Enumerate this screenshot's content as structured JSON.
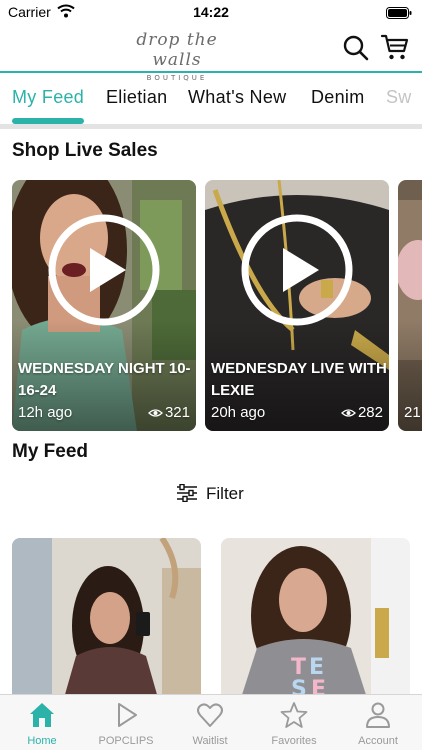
{
  "status": {
    "carrier": "Carrier",
    "time": "14:22"
  },
  "brand": {
    "logo_script": "drop the walls",
    "logo_sub": "BOUTIQUE"
  },
  "colors": {
    "accent": "#2bb3a9",
    "nav_inactive": "#9a9a9a"
  },
  "tabs": [
    {
      "label": "My Feed",
      "active": true
    },
    {
      "label": "Elietian"
    },
    {
      "label": "What's New"
    },
    {
      "label": "Denim"
    },
    {
      "label": "Sw"
    }
  ],
  "live_sales": {
    "title": "Shop Live Sales",
    "cards": [
      {
        "title": "WEDNESDAY NIGHT 10-16-24",
        "time": "12h ago",
        "views": "321"
      },
      {
        "title": "WEDNESDAY LIVE WITH LEXIE",
        "time": "20h ago",
        "views": "282"
      },
      {
        "time": "21"
      }
    ]
  },
  "feed": {
    "title": "My Feed",
    "filter_label": "Filter"
  },
  "bottom_nav": [
    {
      "label": "Home",
      "icon": "home-icon",
      "active": true
    },
    {
      "label": "POPCLIPS",
      "icon": "play-icon"
    },
    {
      "label": "Waitlist",
      "icon": "heart-icon"
    },
    {
      "label": "Favorites",
      "icon": "star-icon"
    },
    {
      "label": "Account",
      "icon": "person-icon"
    }
  ]
}
